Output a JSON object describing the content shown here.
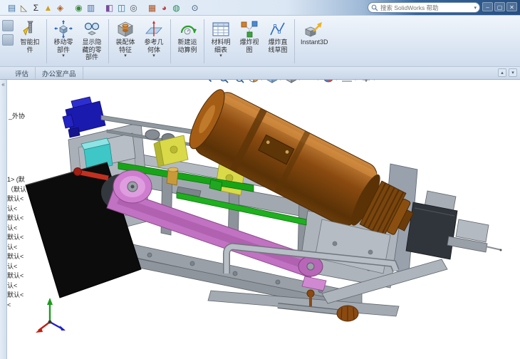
{
  "titlebar": {
    "search_placeholder": "搜索 SolidWorks 帮助",
    "icons": [
      {
        "name": "design-library-icon",
        "glyph": "▤",
        "color": "#3a6fa0"
      },
      {
        "name": "measure-icon",
        "glyph": "◺",
        "color": "#8a6a2a"
      },
      {
        "name": "mass-properties-icon",
        "glyph": "Σ",
        "color": "#2a2a2a"
      },
      {
        "name": "check-entity-icon",
        "glyph": "▲",
        "color": "#d4a017"
      },
      {
        "name": "section-properties-icon",
        "glyph": "◈",
        "color": "#b06020"
      },
      {
        "name": "sensor-icon",
        "glyph": "◉",
        "color": "#3a8a3a",
        "gap": true
      },
      {
        "name": "statistics-icon",
        "glyph": "▥",
        "color": "#4a6fa5"
      },
      {
        "name": "interference-detection-icon",
        "glyph": "◧",
        "color": "#7a4a9a",
        "gap": true
      },
      {
        "name": "clearance-verification-icon",
        "glyph": "◫",
        "color": "#2a7a8a"
      },
      {
        "name": "hole-alignment-icon",
        "glyph": "◎",
        "color": "#5a5a5a"
      },
      {
        "name": "toolbox-icon",
        "glyph": "▦",
        "color": "#b05020",
        "gap": true
      },
      {
        "name": "appearance-icon",
        "glyph": "◕",
        "color": "#c03a3a"
      },
      {
        "name": "scene-icon",
        "glyph": "◍",
        "color": "#2a8a5a"
      },
      {
        "name": "options-icon",
        "glyph": "⊙",
        "color": "#3a5a7a",
        "gap": true
      }
    ],
    "window_buttons": [
      {
        "name": "minimize-button",
        "glyph": "–"
      },
      {
        "name": "maximize-button",
        "glyph": "▢"
      },
      {
        "name": "close-button",
        "glyph": "✕"
      }
    ]
  },
  "ribbon": {
    "buttons": [
      {
        "name": "smart-fasteners",
        "label_lines": [
          "智能扣",
          "件"
        ],
        "dropdown": false,
        "sep_after": true
      },
      {
        "name": "move-component",
        "label_lines": [
          "移动零",
          "部件"
        ],
        "dropdown": true,
        "sep_after": false
      },
      {
        "name": "show-hidden-components",
        "label_lines": [
          "显示隐",
          "藏的零",
          "部件"
        ],
        "dropdown": false,
        "sep_after": true
      },
      {
        "name": "assembly-features",
        "label_lines": [
          "装配体",
          "特征"
        ],
        "dropdown": true,
        "sep_after": false
      },
      {
        "name": "reference-geometry",
        "label_lines": [
          "参考几",
          "何体"
        ],
        "dropdown": true,
        "sep_after": true
      },
      {
        "name": "new-motion-study",
        "label_lines": [
          "新建运",
          "动算例"
        ],
        "dropdown": false,
        "sep_after": true
      },
      {
        "name": "bill-of-materials",
        "label_lines": [
          "材料明",
          "细表"
        ],
        "dropdown": true,
        "sep_after": false
      },
      {
        "name": "exploded-view",
        "label_lines": [
          "爆炸视",
          "图"
        ],
        "dropdown": false,
        "sep_after": false
      },
      {
        "name": "explode-line-sketch",
        "label_lines": [
          "爆炸直",
          "线草图"
        ],
        "dropdown": false,
        "sep_after": true
      },
      {
        "name": "instant3d",
        "label_lines": [
          "Instant3D"
        ],
        "dropdown": false,
        "sep_after": false
      }
    ]
  },
  "tabs": {
    "items": [
      {
        "name": "tab-evaluate",
        "label": "评估"
      },
      {
        "name": "tab-office-products",
        "label": "办公室产品"
      }
    ],
    "corner_buttons": [
      {
        "name": "collapse-ribbon-button",
        "glyph": "▴"
      },
      {
        "name": "ribbon-options-button",
        "glyph": "▾"
      }
    ]
  },
  "panel": {
    "collapse_glyph": "«"
  },
  "headsup": {
    "icons": [
      {
        "name": "zoom-fit",
        "caret": false
      },
      {
        "name": "zoom-area",
        "caret": false
      },
      {
        "name": "previous-view",
        "caret": false
      },
      {
        "name": "section-view",
        "caret": true
      },
      {
        "name": "view-orientation",
        "caret": true
      },
      {
        "name": "display-style",
        "caret": true
      },
      {
        "name": "hide-show-items",
        "caret": true
      },
      {
        "name": "edit-appearance",
        "caret": true
      },
      {
        "name": "apply-scene",
        "caret": true
      },
      {
        "name": "view-settings",
        "caret": true
      }
    ]
  },
  "tree": {
    "fragments": [
      "_外协",
      "1> (默",
      "（默认",
      "默认<",
      "认<",
      "默认<",
      "认<",
      "默认<",
      "认<",
      "默认<",
      "认<",
      "默认<",
      "认<",
      "默认<",
      "<"
    ]
  }
}
